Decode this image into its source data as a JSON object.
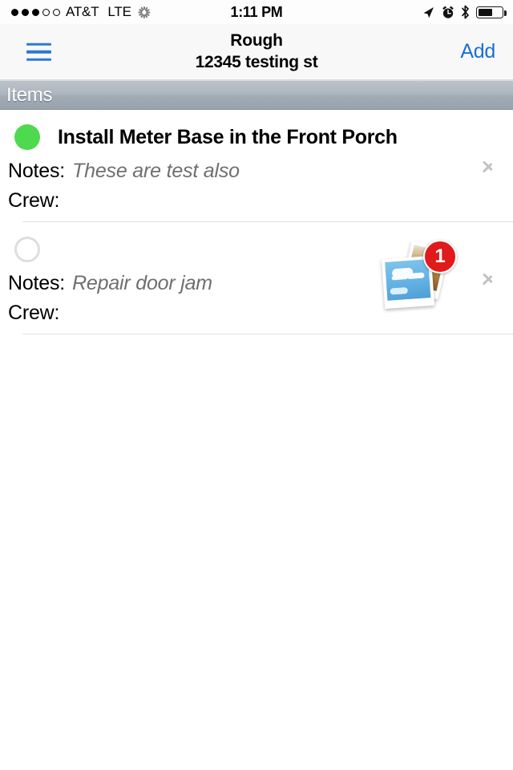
{
  "status_bar": {
    "signal_bars_total": 5,
    "signal_bars_filled": 3,
    "carrier": "AT&T",
    "network": "LTE",
    "activity_icon": "spinner-icon",
    "time": "1:11 PM",
    "location_icon": "location-arrow-icon",
    "alarm_icon": "alarm-clock-icon",
    "bluetooth_icon": "bluetooth-icon",
    "battery_percent": 58
  },
  "nav_bar": {
    "menu_icon": "hamburger-menu-icon",
    "title": "Rough",
    "subtitle": "12345 testing st",
    "add_label": "Add",
    "accent_color": "#1a6fd4"
  },
  "section": {
    "header_label": "Items"
  },
  "labels": {
    "notes": "Notes:",
    "crew": "Crew:"
  },
  "items": [
    {
      "status": "complete",
      "status_color": "#4ed94e",
      "title": "Install Meter Base in the Front Porch",
      "notes": "These are test also",
      "crew": "",
      "photo_count": null,
      "disclosure_icon": "chevron-right-icon"
    },
    {
      "status": "incomplete",
      "status_color": "#dedede",
      "title": "",
      "notes": "Repair door jam",
      "crew": "",
      "photo_count": "1",
      "photos_icon": "photos-stack-icon",
      "disclosure_icon": "chevron-right-icon"
    }
  ]
}
